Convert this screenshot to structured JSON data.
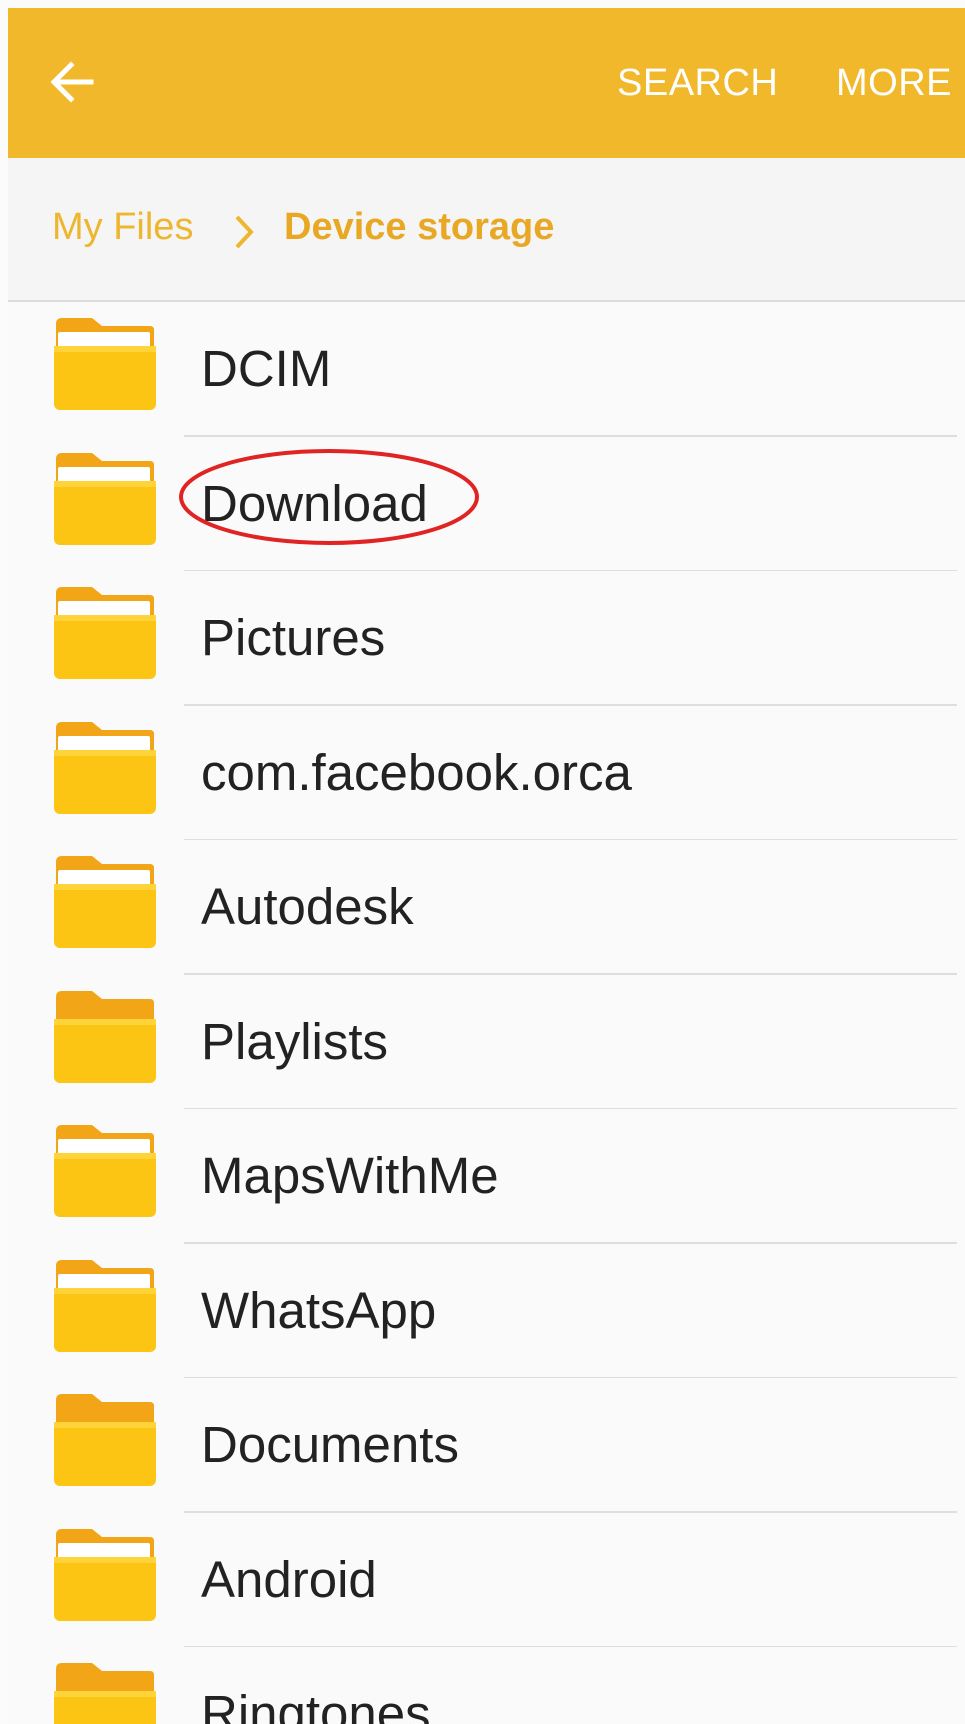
{
  "appbar": {
    "back_icon": "arrow-left-icon",
    "search_label": "SEARCH",
    "more_label": "MORE",
    "bg_color": "#f0b82a"
  },
  "breadcrumb": {
    "root_label": "My Files",
    "separator_icon": "chevron-right-icon",
    "current_label": "Device storage",
    "accent_color": "#eeb62e"
  },
  "folders": [
    {
      "name": "DCIM",
      "icon": "folder-icon",
      "variant": "with-paper"
    },
    {
      "name": "Download",
      "icon": "folder-icon",
      "variant": "with-paper",
      "highlighted": true
    },
    {
      "name": "Pictures",
      "icon": "folder-icon",
      "variant": "with-paper"
    },
    {
      "name": "com.facebook.orca",
      "icon": "folder-icon",
      "variant": "with-paper"
    },
    {
      "name": "Autodesk",
      "icon": "folder-icon",
      "variant": "with-paper"
    },
    {
      "name": "Playlists",
      "icon": "folder-icon",
      "variant": "empty"
    },
    {
      "name": "MapsWithMe",
      "icon": "folder-icon",
      "variant": "with-paper"
    },
    {
      "name": "WhatsApp",
      "icon": "folder-icon",
      "variant": "with-paper"
    },
    {
      "name": "Documents",
      "icon": "folder-icon",
      "variant": "empty"
    },
    {
      "name": "Android",
      "icon": "folder-icon",
      "variant": "with-paper"
    },
    {
      "name": "Ringtones",
      "icon": "folder-icon",
      "variant": "empty"
    }
  ],
  "annotation": {
    "color": "#e02424",
    "shape": "ellipse",
    "target": "Download"
  }
}
